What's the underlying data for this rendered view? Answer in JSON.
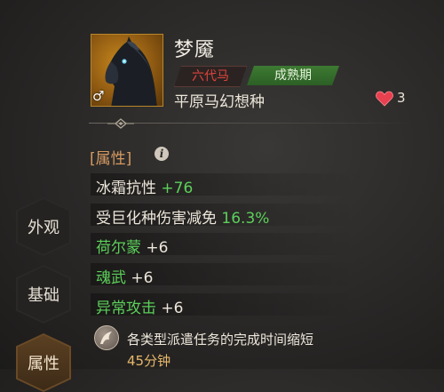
{
  "horse": {
    "name": "梦魇",
    "generation_tag": "六代马",
    "stage_tag": "成熟期",
    "breed": "平原马幻想种",
    "gender_symbol": "♂",
    "likes": "3"
  },
  "attributes": {
    "header": "[属性]",
    "info_icon": "i",
    "rows": [
      {
        "label": "冰霜抗性",
        "value": "+76",
        "label_color": "white",
        "value_color": "green"
      },
      {
        "label": "受巨化种伤害减免",
        "value": "16.3%",
        "label_color": "white",
        "value_color": "green"
      },
      {
        "label": "荷尔蒙",
        "value": "+6",
        "label_color": "green",
        "value_color": "white"
      },
      {
        "label": "魂武",
        "value": "+6",
        "label_color": "green",
        "value_color": "white"
      },
      {
        "label": "异常攻击",
        "value": "+6",
        "label_color": "green",
        "value_color": "white"
      }
    ]
  },
  "tabs": [
    "外观",
    "基础",
    "属性"
  ],
  "active_tab": "属性",
  "skill": {
    "icon": "horse-skill-icon",
    "description": "各类型派遣任务的完成时间缩短",
    "time": "45分钟"
  },
  "colors": {
    "accent_gold": "#b8862a",
    "green": "#5cd05a",
    "red_tag": "#e0443c",
    "heart": "#e8404e",
    "section_header": "#d59a61"
  }
}
